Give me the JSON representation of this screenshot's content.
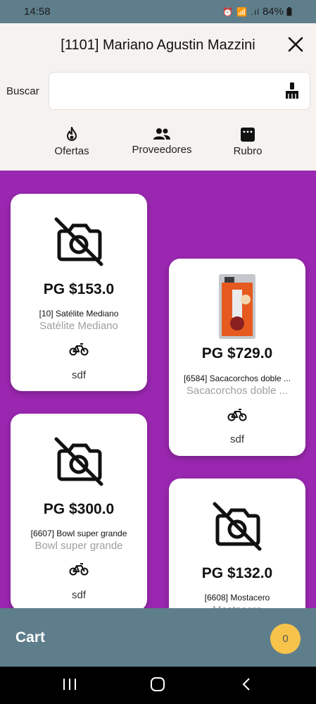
{
  "status_bar": {
    "time": "14:58",
    "icons": "⏰ 📶 .ıl",
    "battery": "84%"
  },
  "header": {
    "title": "[1101] Mariano Agustin Mazzini",
    "search_label": "Buscar",
    "search_value": "",
    "search_placeholder": ""
  },
  "nav": [
    {
      "label": "Ofertas",
      "icon": "fire-icon"
    },
    {
      "label": "Proveedores",
      "icon": "people-icon"
    },
    {
      "label": "Rubro",
      "icon": "category-icon"
    }
  ],
  "products": [
    {
      "price": "PG $153.0",
      "name": "[10] Satélite Mediano",
      "subtitle": "Satélite Mediano",
      "note": "sdf",
      "image": "no-photo-icon"
    },
    {
      "price": "PG $729.0",
      "name": "[6584] Sacacorchos doble ...",
      "subtitle": "Sacacorchos doble ...",
      "note": "sdf",
      "image": "corkscrew-product-image"
    },
    {
      "price": "PG $300.0",
      "name": "[6607] Bowl super grande",
      "subtitle": "Bowl super grande",
      "note": "sdf",
      "image": "no-photo-icon"
    },
    {
      "price": "PG $132.0",
      "name": "[6608] Mostacero",
      "subtitle": "Mostacero",
      "note": "",
      "image": "no-photo-icon"
    }
  ],
  "cart": {
    "label": "Cart",
    "count": "0"
  },
  "colors": {
    "accent": "#9a27b0",
    "bar": "#5f7e8b",
    "badge": "#f7c34a"
  }
}
